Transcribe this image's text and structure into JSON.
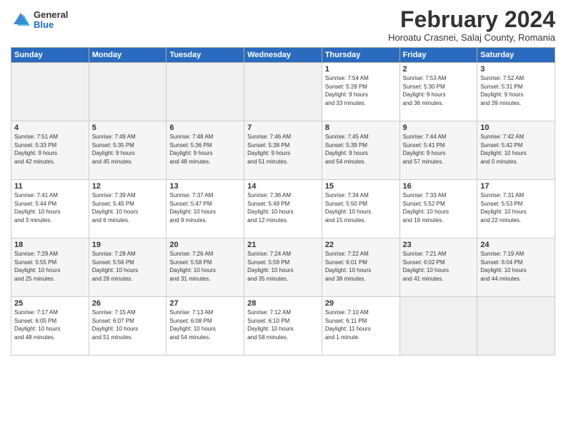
{
  "logo": {
    "general": "General",
    "blue": "Blue"
  },
  "title": "February 2024",
  "location": "Horoatu Crasnei, Salaj County, Romania",
  "days_of_week": [
    "Sunday",
    "Monday",
    "Tuesday",
    "Wednesday",
    "Thursday",
    "Friday",
    "Saturday"
  ],
  "weeks": [
    [
      {
        "day": "",
        "info": ""
      },
      {
        "day": "",
        "info": ""
      },
      {
        "day": "",
        "info": ""
      },
      {
        "day": "",
        "info": ""
      },
      {
        "day": "1",
        "info": "Sunrise: 7:54 AM\nSunset: 5:28 PM\nDaylight: 9 hours\nand 33 minutes."
      },
      {
        "day": "2",
        "info": "Sunrise: 7:53 AM\nSunset: 5:30 PM\nDaylight: 9 hours\nand 36 minutes."
      },
      {
        "day": "3",
        "info": "Sunrise: 7:52 AM\nSunset: 5:31 PM\nDaylight: 9 hours\nand 39 minutes."
      }
    ],
    [
      {
        "day": "4",
        "info": "Sunrise: 7:51 AM\nSunset: 5:33 PM\nDaylight: 9 hours\nand 42 minutes."
      },
      {
        "day": "5",
        "info": "Sunrise: 7:49 AM\nSunset: 5:35 PM\nDaylight: 9 hours\nand 45 minutes."
      },
      {
        "day": "6",
        "info": "Sunrise: 7:48 AM\nSunset: 5:36 PM\nDaylight: 9 hours\nand 48 minutes."
      },
      {
        "day": "7",
        "info": "Sunrise: 7:46 AM\nSunset: 5:38 PM\nDaylight: 9 hours\nand 51 minutes."
      },
      {
        "day": "8",
        "info": "Sunrise: 7:45 AM\nSunset: 5:39 PM\nDaylight: 9 hours\nand 54 minutes."
      },
      {
        "day": "9",
        "info": "Sunrise: 7:44 AM\nSunset: 5:41 PM\nDaylight: 9 hours\nand 57 minutes."
      },
      {
        "day": "10",
        "info": "Sunrise: 7:42 AM\nSunset: 5:42 PM\nDaylight: 10 hours\nand 0 minutes."
      }
    ],
    [
      {
        "day": "11",
        "info": "Sunrise: 7:41 AM\nSunset: 5:44 PM\nDaylight: 10 hours\nand 3 minutes."
      },
      {
        "day": "12",
        "info": "Sunrise: 7:39 AM\nSunset: 5:45 PM\nDaylight: 10 hours\nand 6 minutes."
      },
      {
        "day": "13",
        "info": "Sunrise: 7:37 AM\nSunset: 5:47 PM\nDaylight: 10 hours\nand 9 minutes."
      },
      {
        "day": "14",
        "info": "Sunrise: 7:36 AM\nSunset: 5:49 PM\nDaylight: 10 hours\nand 12 minutes."
      },
      {
        "day": "15",
        "info": "Sunrise: 7:34 AM\nSunset: 5:50 PM\nDaylight: 10 hours\nand 15 minutes."
      },
      {
        "day": "16",
        "info": "Sunrise: 7:33 AM\nSunset: 5:52 PM\nDaylight: 10 hours\nand 19 minutes."
      },
      {
        "day": "17",
        "info": "Sunrise: 7:31 AM\nSunset: 5:53 PM\nDaylight: 10 hours\nand 22 minutes."
      }
    ],
    [
      {
        "day": "18",
        "info": "Sunrise: 7:29 AM\nSunset: 5:55 PM\nDaylight: 10 hours\nand 25 minutes."
      },
      {
        "day": "19",
        "info": "Sunrise: 7:28 AM\nSunset: 5:56 PM\nDaylight: 10 hours\nand 28 minutes."
      },
      {
        "day": "20",
        "info": "Sunrise: 7:26 AM\nSunset: 5:58 PM\nDaylight: 10 hours\nand 31 minutes."
      },
      {
        "day": "21",
        "info": "Sunrise: 7:24 AM\nSunset: 5:59 PM\nDaylight: 10 hours\nand 35 minutes."
      },
      {
        "day": "22",
        "info": "Sunrise: 7:22 AM\nSunset: 6:01 PM\nDaylight: 10 hours\nand 38 minutes."
      },
      {
        "day": "23",
        "info": "Sunrise: 7:21 AM\nSunset: 6:02 PM\nDaylight: 10 hours\nand 41 minutes."
      },
      {
        "day": "24",
        "info": "Sunrise: 7:19 AM\nSunset: 6:04 PM\nDaylight: 10 hours\nand 44 minutes."
      }
    ],
    [
      {
        "day": "25",
        "info": "Sunrise: 7:17 AM\nSunset: 6:05 PM\nDaylight: 10 hours\nand 48 minutes."
      },
      {
        "day": "26",
        "info": "Sunrise: 7:15 AM\nSunset: 6:07 PM\nDaylight: 10 hours\nand 51 minutes."
      },
      {
        "day": "27",
        "info": "Sunrise: 7:13 AM\nSunset: 6:08 PM\nDaylight: 10 hours\nand 54 minutes."
      },
      {
        "day": "28",
        "info": "Sunrise: 7:12 AM\nSunset: 6:10 PM\nDaylight: 10 hours\nand 58 minutes."
      },
      {
        "day": "29",
        "info": "Sunrise: 7:10 AM\nSunset: 6:11 PM\nDaylight: 11 hours\nand 1 minute."
      },
      {
        "day": "",
        "info": ""
      },
      {
        "day": "",
        "info": ""
      }
    ]
  ]
}
